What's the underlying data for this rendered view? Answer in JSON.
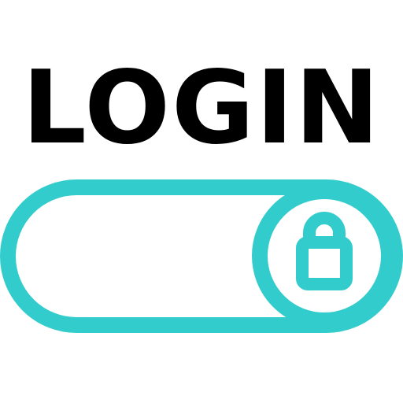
{
  "title": "LOGIN",
  "colors": {
    "accent": "#33CCCC",
    "text": "#000000",
    "background": "#FFFFFF"
  },
  "toggle": {
    "icon": "lock-icon"
  }
}
